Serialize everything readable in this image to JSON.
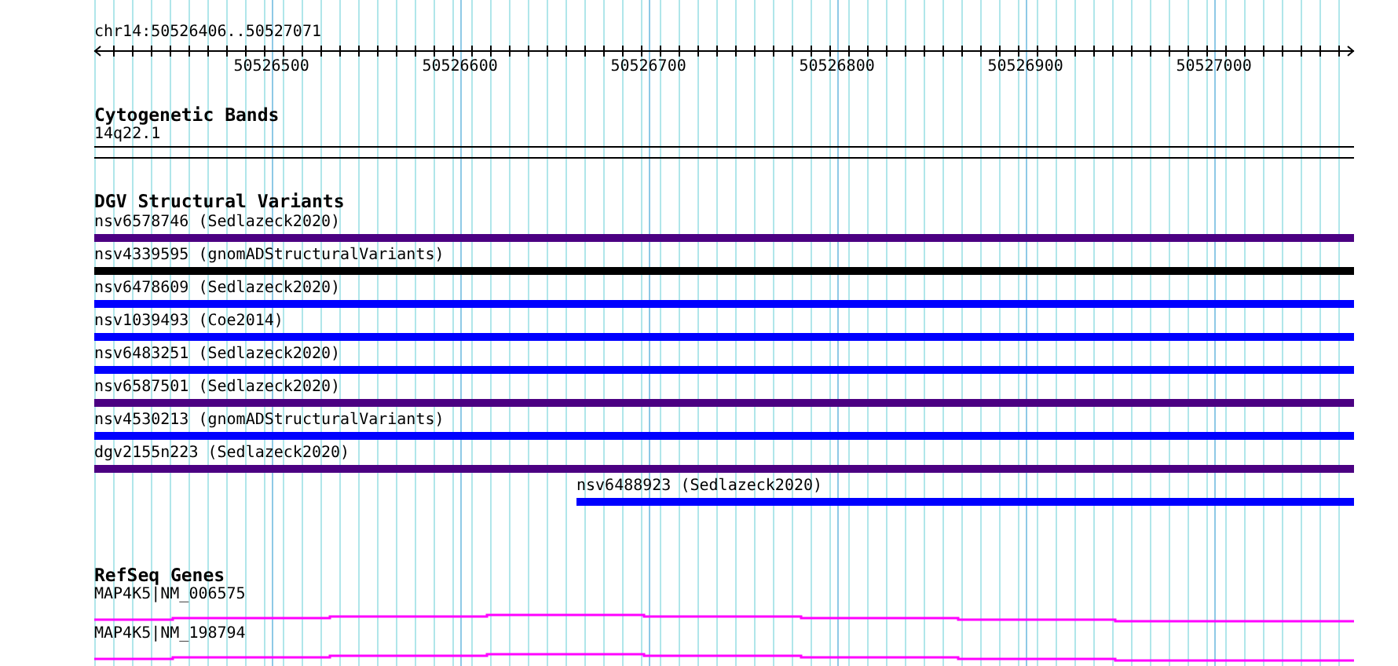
{
  "ruler": {
    "label": "chr14:50526406..50527071",
    "ticks": [
      "50526500",
      "50526600",
      "50526700",
      "50526800",
      "50526900",
      "50527000"
    ]
  },
  "cytogenetic_bands": {
    "title": "Cytogenetic Bands",
    "band": "14q22.1"
  },
  "dgv_structural_variants": {
    "title": "DGV Structural Variants",
    "features": [
      {
        "label": "nsv6578746 (Sedlazeck2020)",
        "color": "#4b0082",
        "kind": "full"
      },
      {
        "label": "nsv4339595 (gnomADStructuralVariants)",
        "color": "#000000",
        "kind": "full"
      },
      {
        "label": "nsv6478609 (Sedlazeck2020)",
        "color": "#0000ff",
        "kind": "full"
      },
      {
        "label": "nsv1039493 (Coe2014)",
        "color": "#0000ff",
        "kind": "full"
      },
      {
        "label": "nsv6483251 (Sedlazeck2020)",
        "color": "#0000ff",
        "kind": "full"
      },
      {
        "label": "nsv6587501 (Sedlazeck2020)",
        "color": "#4b0082",
        "kind": "full"
      },
      {
        "label": "nsv4530213 (gnomADStructuralVariants)",
        "color": "#0000ff",
        "kind": "full"
      },
      {
        "label": "dgv2155n223 (Sedlazeck2020)",
        "color": "#4b0082",
        "kind": "full"
      },
      {
        "label": "nsv6488923 (Sedlazeck2020)",
        "color": "#0000ff",
        "kind": "partial"
      }
    ]
  },
  "refseq_genes": {
    "title": "RefSeq Genes",
    "transcripts": [
      {
        "label": "MAP4K5|NM_006575"
      },
      {
        "label": "MAP4K5|NM_198794"
      }
    ]
  }
}
